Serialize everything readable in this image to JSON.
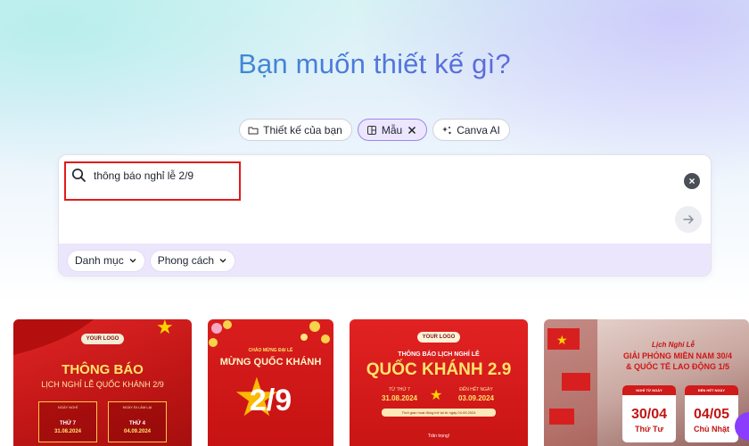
{
  "hero": {
    "headline": "Bạn muốn thiết kế gì?"
  },
  "tabs": [
    {
      "label": "Thiết kế của bạn",
      "icon": "folder-icon"
    },
    {
      "label": "Mẫu",
      "icon": "template-icon",
      "active": true
    },
    {
      "label": "Canva AI",
      "icon": "sparkle-icon"
    }
  ],
  "search": {
    "value": "thông báo nghỉ lễ 2/9",
    "clear_glyph": "×"
  },
  "filters": [
    {
      "label": "Danh mục"
    },
    {
      "label": "Phong cách"
    }
  ],
  "templates": {
    "t1": {
      "logo": "YOUR LOGO",
      "title": "THÔNG BÁO",
      "subtitle": "LỊCH NGHỈ LỄ QUỐC KHÁNH 2/9",
      "left_label": "NGÀY NGHỈ",
      "left_day": "THỨ 7",
      "left_date": "31.08.2024",
      "right_label": "NGÀY ĐI LÀM LẠI",
      "right_day": "THỨ 4",
      "right_date": "04.09.2024"
    },
    "t2": {
      "small": "CHÀO MỪNG ĐẠI LỄ",
      "title": "MỪNG QUỐC KHÁNH",
      "big": "2/9"
    },
    "t3": {
      "logo": "YOUR LOGO",
      "heading": "THÔNG BÁO LỊCH NGHỈ LỄ",
      "title": "QUỐC KHÁNH 2.9",
      "from_label": "TỪ THỨ 7",
      "from_date": "31.08.2024",
      "to_label": "ĐẾN HẾT NGÀY",
      "to_date": "03.09.2024",
      "note": "Thời gian hoạt động trở lại từ ngày 04.09.2024",
      "footer": "Trân trọng!"
    },
    "t4": {
      "heading": "Lịch Nghỉ Lễ",
      "title_line1": "GIẢI PHÓNG MIỀN NAM 30/4",
      "title_line2": "& QUỐC TẾ LAO ĐỘNG 1/5",
      "cal1_label": "NGHỈ TỪ NGÀY",
      "cal1_date": "30/04",
      "cal1_day": "Thứ Tư",
      "cal2_label": "ĐẾN HẾT NGÀY",
      "cal2_date": "04/05",
      "cal2_day": "Chủ Nhật"
    }
  },
  "colors": {
    "accent_purple": "#7b4fe0",
    "highlight_red": "#e01b1b",
    "template_red": "#d11a1a",
    "template_gold": "#ffd200"
  }
}
